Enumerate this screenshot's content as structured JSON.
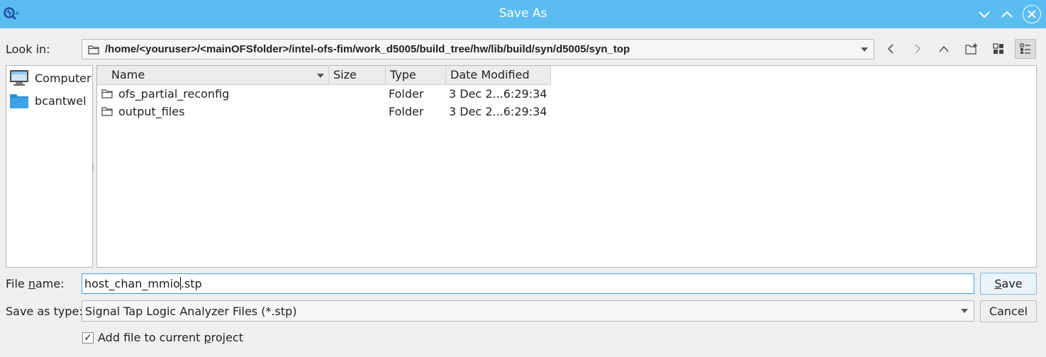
{
  "window": {
    "title": "Save As"
  },
  "look_in": {
    "label": "Look in:",
    "path": "/home/<youruser>/<mainOFSfolder>/intel-ofs-fim/work_d5005/build_tree/hw/lib/build/syn/d5005/syn_top"
  },
  "sidebar": {
    "items": [
      {
        "label": "Computer",
        "icon": "computer-icon"
      },
      {
        "label": "bcantwel",
        "icon": "folder-icon"
      }
    ]
  },
  "file_list": {
    "columns": [
      "Name",
      "Size",
      "Type",
      "Date Modified"
    ],
    "rows": [
      {
        "name": "ofs_partial_reconfig",
        "size": "",
        "type": "Folder",
        "date": "3 Dec 2...6:29:34"
      },
      {
        "name": "output_files",
        "size": "",
        "type": "Folder",
        "date": "3 Dec 2...6:29:34"
      }
    ]
  },
  "file_name": {
    "label_pre": "File ",
    "label_u": "n",
    "label_post": "ame:",
    "value_before_caret": "host_chan_mmio",
    "value_after_caret": ".stp"
  },
  "save_type": {
    "label": "Save as type:",
    "value": "Signal Tap Logic Analyzer Files (*.stp)"
  },
  "buttons": {
    "save_u": "S",
    "save_rest": "ave",
    "cancel": "Cancel"
  },
  "add_to_project": {
    "checked": true,
    "check_glyph": "✓",
    "label_pre": "Add file to current ",
    "label_u": "p",
    "label_post": "roject"
  },
  "colors": {
    "titlebar": "#5bbcf0",
    "accent": "#3aa0e0"
  }
}
